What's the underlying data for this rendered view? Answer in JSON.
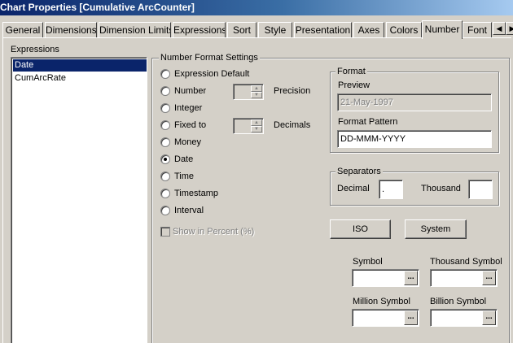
{
  "window": {
    "title": "Chart Properties [Cumulative ArcCounter]"
  },
  "tabs": [
    {
      "label": "General",
      "active": false
    },
    {
      "label": "Dimensions",
      "active": false
    },
    {
      "label": "Dimension Limits",
      "active": false
    },
    {
      "label": "Expressions",
      "active": false
    },
    {
      "label": "Sort",
      "active": false
    },
    {
      "label": "Style",
      "active": false
    },
    {
      "label": "Presentation",
      "active": false
    },
    {
      "label": "Axes",
      "active": false
    },
    {
      "label": "Colors",
      "active": false
    },
    {
      "label": "Number",
      "active": true
    },
    {
      "label": "Font",
      "active": false
    }
  ],
  "tab_scroll": {
    "left_icon": "arrow-left-icon",
    "right_icon": "arrow-right-icon"
  },
  "expressions": {
    "label": "Expressions",
    "items": [
      {
        "label": "Date",
        "selected": true
      },
      {
        "label": "CumArcRate",
        "selected": false
      }
    ]
  },
  "number_format": {
    "group_label": "Number Format Settings",
    "options": [
      {
        "label": "Expression Default",
        "checked": false
      },
      {
        "label": "Number",
        "checked": false
      },
      {
        "label": "Integer",
        "checked": false
      },
      {
        "label": "Fixed to",
        "checked": false
      },
      {
        "label": "Money",
        "checked": false
      },
      {
        "label": "Date",
        "checked": true
      },
      {
        "label": "Time",
        "checked": false
      },
      {
        "label": "Timestamp",
        "checked": false
      },
      {
        "label": "Interval",
        "checked": false
      }
    ],
    "precision_label": "Precision",
    "decimals_label": "Decimals",
    "show_in_percent_label": "Show in Percent (%)",
    "show_in_percent_checked": false
  },
  "format": {
    "group_label": "Format",
    "preview_label": "Preview",
    "preview_value": "21-May-1997",
    "pattern_label": "Format Pattern",
    "pattern_value": "DD-MMM-YYYY"
  },
  "separators": {
    "group_label": "Separators",
    "decimal_label": "Decimal",
    "decimal_value": ".",
    "thousand_label": "Thousand",
    "thousand_value": ""
  },
  "buttons": {
    "iso_label": "ISO",
    "system_label": "System"
  },
  "symbols": {
    "symbol_label": "Symbol",
    "thousand_symbol_label": "Thousand Symbol",
    "million_symbol_label": "Million Symbol",
    "billion_symbol_label": "Billion Symbol",
    "ellipsis": "..."
  }
}
